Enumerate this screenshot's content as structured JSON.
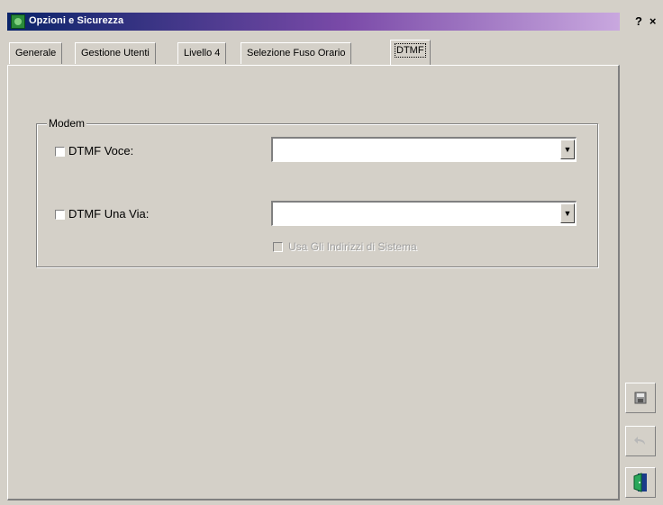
{
  "window": {
    "title": "Opzioni e Sicurezza",
    "help_button": "?",
    "close_button": "×"
  },
  "tabs": [
    {
      "label": "Generale"
    },
    {
      "label": "Gestione Utenti"
    },
    {
      "label": "Livello 4"
    },
    {
      "label": "Selezione Fuso Orario"
    },
    {
      "label": "DTMF",
      "active": true
    }
  ],
  "modem": {
    "group_label": "Modem",
    "voce": {
      "label": "DTMF Voce:",
      "checked": false,
      "value": ""
    },
    "una_via": {
      "label": "DTMF Una Via:",
      "checked": false,
      "value": ""
    },
    "usa_indirizzi": {
      "label": "Usa Gli Indirizzi di Sistema",
      "checked": false,
      "enabled": false
    }
  },
  "side_buttons": [
    {
      "name": "save",
      "icon": "floppy-disk-icon",
      "enabled": true
    },
    {
      "name": "undo",
      "icon": "undo-arrow-icon",
      "enabled": false
    },
    {
      "name": "exit",
      "icon": "exit-door-icon",
      "enabled": true
    }
  ],
  "colors": {
    "title_start": "#0a246a",
    "title_end": "#c9a8df",
    "face": "#d4d0c8"
  }
}
